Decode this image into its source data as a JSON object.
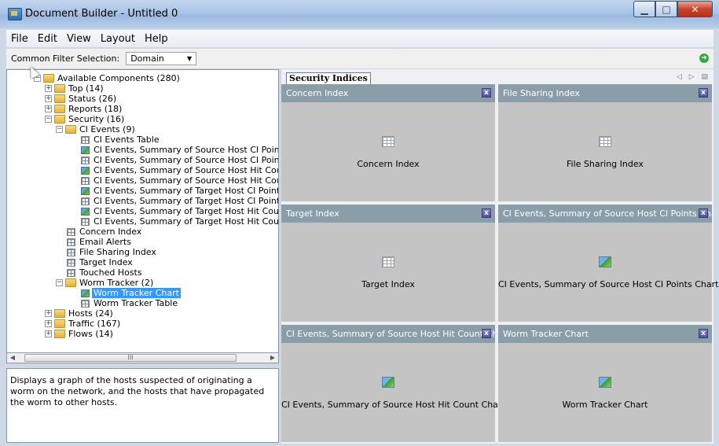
{
  "window": {
    "title": "Document Builder - Untitled 0"
  },
  "menu": [
    "File",
    "Edit",
    "View",
    "Layout",
    "Help"
  ],
  "filter": {
    "label": "Common Filter Selection:",
    "value": "Domain"
  },
  "tree": [
    {
      "level": 0,
      "expander": "minus",
      "icon": "folder",
      "label": "Available Components (280)"
    },
    {
      "level": 1,
      "expander": "plus",
      "icon": "folder",
      "label": "Top (14)"
    },
    {
      "level": 1,
      "expander": "plus",
      "icon": "folder",
      "label": "Status (26)"
    },
    {
      "level": 1,
      "expander": "plus",
      "icon": "folder",
      "label": "Reports (18)"
    },
    {
      "level": 1,
      "expander": "minus",
      "icon": "folder",
      "label": "Security (16)"
    },
    {
      "level": 2,
      "expander": "minus",
      "icon": "folder",
      "label": "CI Events (9)"
    },
    {
      "level": 3,
      "expander": "",
      "icon": "table",
      "label": "CI Events Table"
    },
    {
      "level": 3,
      "expander": "",
      "icon": "chart",
      "label": "CI Events, Summary of Source Host CI Points Chart"
    },
    {
      "level": 3,
      "expander": "",
      "icon": "table",
      "label": "CI Events, Summary of Source Host CI Points Table"
    },
    {
      "level": 3,
      "expander": "",
      "icon": "chart",
      "label": "CI Events, Summary of Source Host Hit Count Chart"
    },
    {
      "level": 3,
      "expander": "",
      "icon": "table",
      "label": "CI Events, Summary of Source Host Hit Count Table"
    },
    {
      "level": 3,
      "expander": "",
      "icon": "chart",
      "label": "CI Events, Summary of Target Host CI Points Chart"
    },
    {
      "level": 3,
      "expander": "",
      "icon": "table",
      "label": "CI Events, Summary of Target Host CI Points Table"
    },
    {
      "level": 3,
      "expander": "",
      "icon": "chart",
      "label": "CI Events, Summary of Target Host Hit Count Chart"
    },
    {
      "level": 3,
      "expander": "",
      "icon": "table",
      "label": "CI Events, Summary of Target Host Hit Count Table"
    },
    {
      "level": 2,
      "expander": "",
      "icon": "table",
      "label": "Concern Index"
    },
    {
      "level": 2,
      "expander": "",
      "icon": "table",
      "label": "Email Alerts"
    },
    {
      "level": 2,
      "expander": "",
      "icon": "table",
      "label": "File Sharing Index"
    },
    {
      "level": 2,
      "expander": "",
      "icon": "table",
      "label": "Target Index"
    },
    {
      "level": 2,
      "expander": "",
      "icon": "table",
      "label": "Touched Hosts"
    },
    {
      "level": 2,
      "expander": "minus",
      "icon": "folder",
      "label": "Worm Tracker (2)"
    },
    {
      "level": 3,
      "expander": "",
      "icon": "chart",
      "label": "Worm Tracker Chart",
      "selected": true
    },
    {
      "level": 3,
      "expander": "",
      "icon": "table",
      "label": "Worm Tracker Table"
    },
    {
      "level": 1,
      "expander": "plus",
      "icon": "folder",
      "label": "Hosts (24)"
    },
    {
      "level": 1,
      "expander": "plus",
      "icon": "folder",
      "label": "Traffic (167)"
    },
    {
      "level": 1,
      "expander": "plus",
      "icon": "folder",
      "label": "Flows (14)"
    }
  ],
  "scrollbar": {
    "grip": "III"
  },
  "description": "Displays a graph of the hosts suspected of originating a worm on the network, and the hosts that have propagated the worm to other hosts.",
  "right_panel": {
    "tab": "Security Indices",
    "cards": [
      {
        "title": "Concern Index",
        "icon": "table",
        "label": "Concern Index"
      },
      {
        "title": "File Sharing Index",
        "icon": "table",
        "label": "File Sharing Index"
      },
      {
        "title": "Target Index",
        "icon": "table",
        "label": "Target Index"
      },
      {
        "title": "CI Events, Summary of Source Host CI Points Chart",
        "icon": "chart",
        "label": "CI Events, Summary of Source Host CI Points Chart"
      },
      {
        "title": "CI Events, Summary of Source Host Hit Count Ch...",
        "icon": "chart",
        "label": "CI Events, Summary of Source Host Hit Count Chart"
      },
      {
        "title": "Worm Tracker Chart",
        "icon": "chart",
        "label": "Worm Tracker Chart"
      }
    ]
  }
}
